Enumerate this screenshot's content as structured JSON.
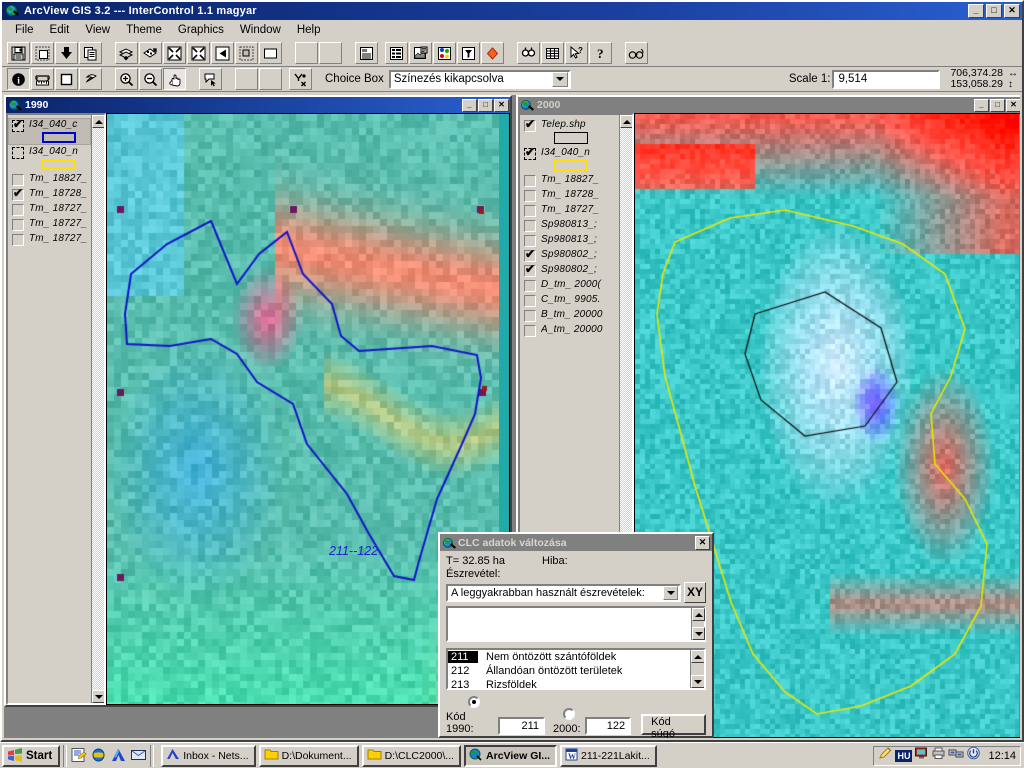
{
  "app": {
    "title": "ArcView GIS 3.2 --- InterControl 1.1 magyar",
    "icon": "arcview-globe-icon",
    "min_label": "_",
    "max_label": "□",
    "close_label": "✕"
  },
  "menu": {
    "items": [
      {
        "label": "File",
        "accel": "F"
      },
      {
        "label": "Edit",
        "accel": "E"
      },
      {
        "label": "View",
        "accel": "V"
      },
      {
        "label": "Theme",
        "accel": "T"
      },
      {
        "label": "Graphics",
        "accel": "G"
      },
      {
        "label": "Window",
        "accel": "W"
      },
      {
        "label": "Help",
        "accel": "H"
      }
    ]
  },
  "toolbar_top": {
    "buttons": [
      {
        "name": "save-project-icon"
      },
      {
        "name": "new-view-icon"
      },
      {
        "name": "add-theme-icon"
      },
      {
        "name": "copy-icon"
      },
      {
        "name": "zoom-to-themes-icon"
      },
      {
        "name": "zoom-to-selected-icon"
      },
      {
        "name": "zoom-in-fixed-icon"
      },
      {
        "name": "zoom-out-fixed-icon"
      },
      {
        "name": "zoom-previous-icon"
      },
      {
        "name": "clear-selection-icon"
      },
      {
        "name": "select-all-icon"
      },
      {
        "name": "blank-button-1"
      },
      {
        "name": "blank-button-2"
      },
      {
        "name": "open-table-icon"
      },
      {
        "name": "attributes-icon"
      },
      {
        "name": "edit-legend-icon"
      },
      {
        "name": "symbol-palette-icon"
      },
      {
        "name": "query-builder-icon"
      },
      {
        "name": "hot-link-icon"
      },
      {
        "name": "find-icon"
      },
      {
        "name": "table-summary-icon"
      },
      {
        "name": "help-pointer-icon"
      },
      {
        "name": "help-icon"
      },
      {
        "name": "glasses-icon"
      }
    ]
  },
  "toolbar_bottom": {
    "buttons": [
      {
        "name": "identify-tool-icon",
        "pressed": true
      },
      {
        "name": "measure-tool-icon"
      },
      {
        "name": "select-feature-icon"
      },
      {
        "name": "pointer-tool-icon"
      },
      {
        "name": "zoom-in-tool-icon"
      },
      {
        "name": "zoom-out-tool-icon"
      },
      {
        "name": "pan-tool-icon",
        "pressed": true
      },
      {
        "name": "label-tool-icon"
      },
      {
        "name": "blank-tool-1"
      },
      {
        "name": "blank-tool-2"
      },
      {
        "name": "hot-link-tool-icon"
      }
    ],
    "choice_box_label": "Choice Box",
    "choice_box_value": "Színezés kikapcsolva",
    "scale_label": "Scale  1:",
    "scale_value": "9,514",
    "coord_x": "706,374.28",
    "coord_y": "153,058.29",
    "coord_x_icon": "↔",
    "coord_y_icon": "↕"
  },
  "view_1990": {
    "title": "1990",
    "active": true,
    "min_label": "_",
    "max_label": "□",
    "close_label": "✕",
    "map_label": "211--122",
    "layers": [
      {
        "name": "I34_040_c",
        "checked": true,
        "dashed": true,
        "selected": true,
        "swatch": "blue"
      },
      {
        "name": "I34_040_n",
        "checked": false,
        "dashed": true,
        "selected": false,
        "swatch": "yellow"
      },
      {
        "name": "Tm_ 18827_",
        "checked": false,
        "dashed": false,
        "selected": false,
        "swatch": null
      },
      {
        "name": "Tm_ 18728_",
        "checked": true,
        "dashed": false,
        "selected": false,
        "swatch": null
      },
      {
        "name": "Tm_ 18727_",
        "checked": false,
        "dashed": false,
        "selected": false,
        "swatch": null
      },
      {
        "name": "Tm_ 18727_",
        "checked": false,
        "dashed": false,
        "selected": false,
        "swatch": null
      },
      {
        "name": "Tm_ 18727_",
        "checked": false,
        "dashed": false,
        "selected": false,
        "swatch": null
      }
    ]
  },
  "view_2000": {
    "title": "2000",
    "active": false,
    "min_label": "_",
    "max_label": "□",
    "close_label": "✕",
    "layers": [
      {
        "name": "Telep.shp",
        "checked": true,
        "dashed": false,
        "selected": false,
        "swatch": "black"
      },
      {
        "name": "I34_040_n",
        "checked": true,
        "dashed": true,
        "selected": false,
        "swatch": "yellow"
      },
      {
        "name": "Tm_ 18827_",
        "checked": false,
        "dashed": false,
        "selected": false,
        "swatch": null
      },
      {
        "name": "Tm_ 18728_",
        "checked": false,
        "dashed": false,
        "selected": false,
        "swatch": null
      },
      {
        "name": "Tm_ 18727_",
        "checked": false,
        "dashed": false,
        "selected": false,
        "swatch": null
      },
      {
        "name": "Sp980813_;",
        "checked": false,
        "dashed": false,
        "selected": false,
        "swatch": null
      },
      {
        "name": "Sp980813_;",
        "checked": false,
        "dashed": false,
        "selected": false,
        "swatch": null
      },
      {
        "name": "Sp980802_;",
        "checked": true,
        "dashed": false,
        "selected": false,
        "swatch": null
      },
      {
        "name": "Sp980802_;",
        "checked": true,
        "dashed": false,
        "selected": false,
        "swatch": null
      },
      {
        "name": "D_tm_ 2000(",
        "checked": false,
        "dashed": false,
        "selected": false,
        "swatch": null
      },
      {
        "name": "C_tm_ 9905.",
        "checked": false,
        "dashed": false,
        "selected": false,
        "swatch": null
      },
      {
        "name": "B_tm_ 20000",
        "checked": false,
        "dashed": false,
        "selected": false,
        "swatch": null
      },
      {
        "name": "A_tm_ 20000",
        "checked": false,
        "dashed": false,
        "selected": false,
        "swatch": null
      }
    ]
  },
  "dialog": {
    "title": "CLC adatok változása",
    "close_label": "✕",
    "area_label": "T= 32.85 ha",
    "error_label": "Hiba:",
    "note_label": "Észrevétel:",
    "combo_value": "A leggyakrabban használt észrevételek:",
    "xy_button": "XY",
    "textarea_value": "",
    "code_list": [
      {
        "code": "211",
        "desc": "Nem öntözött szántóföldek",
        "selected": true
      },
      {
        "code": "212",
        "desc": "Állandóan öntözött területek",
        "selected": false
      },
      {
        "code": "213",
        "desc": "Rizsföldek",
        "selected": false
      }
    ],
    "radio_1990_label": "Kód 1990:",
    "radio_1990_selected": true,
    "code_1990_value": "211",
    "radio_2000_label": "2000:",
    "radio_2000_selected": false,
    "code_2000_value": "122",
    "help_button": "Kód súgó"
  },
  "taskbar": {
    "start_label": "Start",
    "quicklaunch": [
      {
        "name": "show-desktop-icon"
      },
      {
        "name": "internet-explorer-icon"
      },
      {
        "name": "netscape-icon"
      },
      {
        "name": "outlook-express-icon"
      }
    ],
    "tasks": [
      {
        "label": "Inbox - Nets...",
        "icon": "netscape-mail-icon",
        "active": false
      },
      {
        "label": "D:\\Dokument...",
        "icon": "folder-icon",
        "active": false
      },
      {
        "label": "D:\\CLC2000\\...",
        "icon": "folder-icon",
        "active": false
      },
      {
        "label": "ArcView GI...",
        "icon": "arcview-globe-icon",
        "active": true
      },
      {
        "label": "211-221Lakit...",
        "icon": "word-document-icon",
        "active": false
      }
    ],
    "tray": [
      {
        "name": "pencil-tray-icon"
      },
      {
        "name": "keyboard-language-icon",
        "label": "HU"
      },
      {
        "name": "display-tray-icon"
      },
      {
        "name": "printer-tray-icon"
      },
      {
        "name": "network-tray-icon"
      },
      {
        "name": "power-tray-icon"
      }
    ],
    "clock": "12:14"
  }
}
